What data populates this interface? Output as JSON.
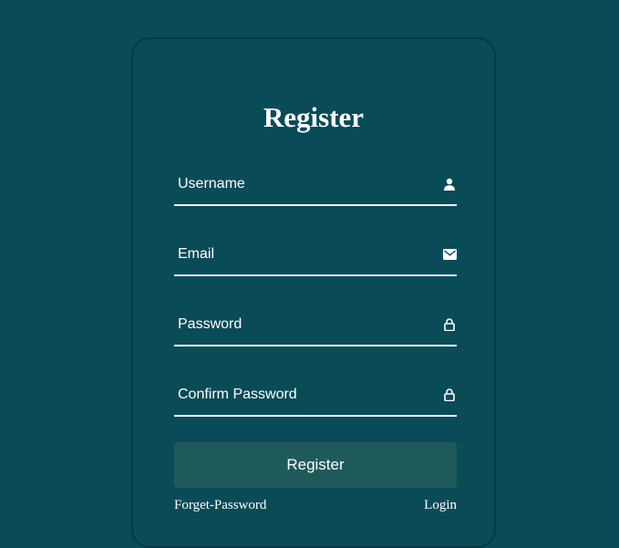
{
  "form": {
    "title": "Register",
    "fields": [
      {
        "placeholder": "Username",
        "value": "",
        "icon": "user-icon"
      },
      {
        "placeholder": "Email",
        "value": "",
        "icon": "envelope-icon"
      },
      {
        "placeholder": "Password",
        "value": "",
        "icon": "lock-icon"
      },
      {
        "placeholder": "Confirm Password",
        "value": "",
        "icon": "lock-icon"
      }
    ],
    "submit_label": "Register",
    "forget_password_label": "Forget-Password",
    "login_label": "Login"
  },
  "colors": {
    "background": "#0a4b58",
    "card_border": "#073846",
    "button": "#1f5a5b",
    "text": "#ffffff"
  }
}
